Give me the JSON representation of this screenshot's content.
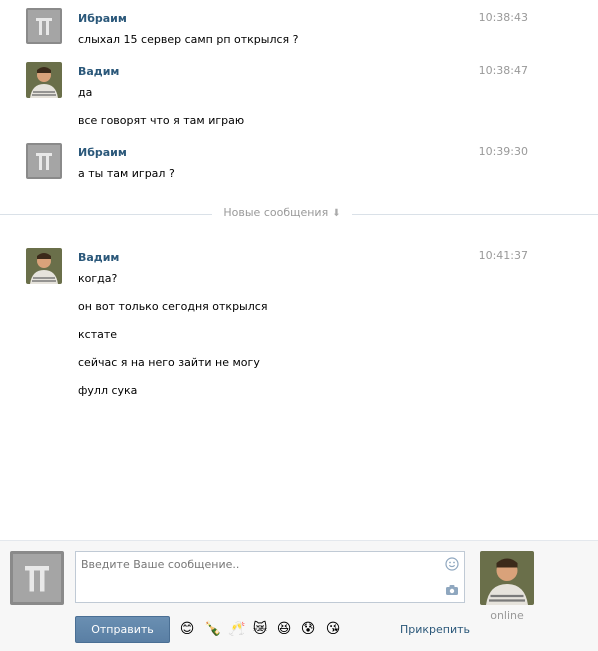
{
  "messages": [
    {
      "author": "Ибраим",
      "time": "10:38:43",
      "avatar": "crest-avatar",
      "lines": [
        "слыхал 15 сервер самп рп открылся ?"
      ]
    },
    {
      "author": "Вадим",
      "time": "10:38:47",
      "avatar": "user-photo-avatar",
      "lines": [
        "да",
        "все говорят что я там играю"
      ]
    },
    {
      "author": "Ибраим",
      "time": "10:39:30",
      "avatar": "crest-avatar",
      "lines": [
        "а ты там играл ?"
      ]
    },
    {
      "author": "Вадим",
      "time": "10:41:37",
      "avatar": "user-photo-avatar",
      "lines": [
        "когда?",
        "он вот только сегодня открылся",
        "кстате",
        "сейчас я на него зайти не могу",
        "фулл сука"
      ]
    }
  ],
  "divider": {
    "label": "Новые сообщения",
    "icon": "arrow-down-icon"
  },
  "composer": {
    "placeholder": "Введите Ваше сообщение..",
    "send_label": "Отправить",
    "attach_label": "Прикрепить",
    "status": "online",
    "emojis": [
      "😊",
      "🍾",
      "🥂",
      "😿",
      "😆",
      "😰",
      "😘"
    ]
  }
}
